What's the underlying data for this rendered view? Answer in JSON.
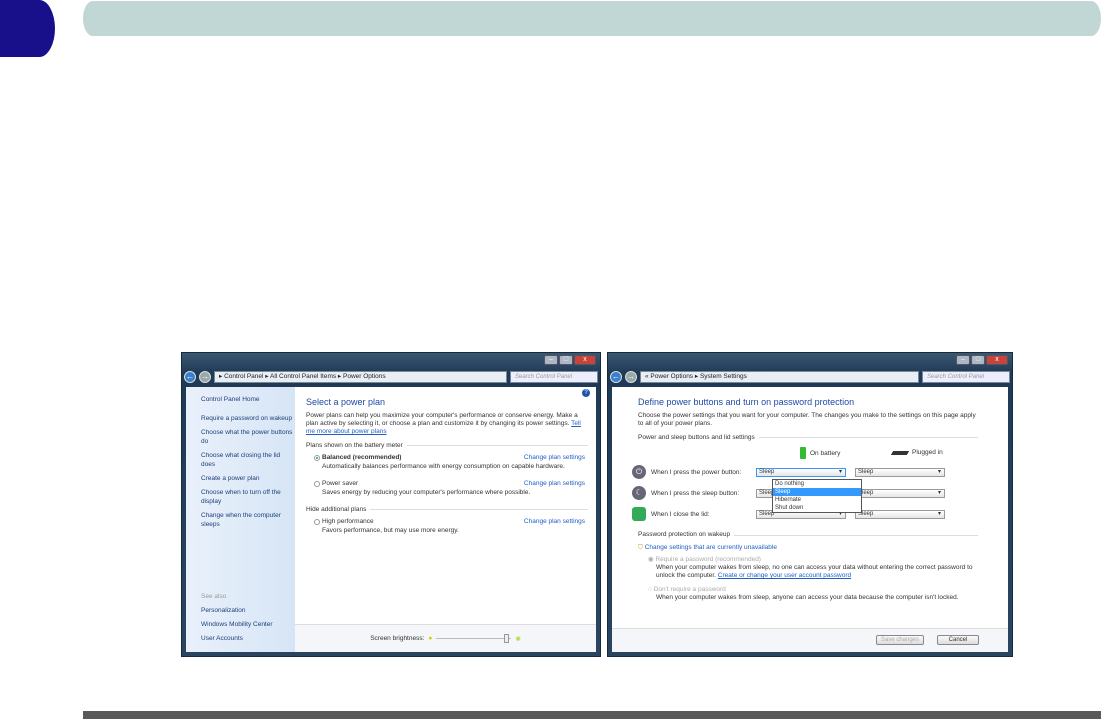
{
  "left_window": {
    "path": [
      "Control Panel",
      "All Control Panel Items",
      "Power Options"
    ],
    "search_placeholder": "Search Control Panel",
    "sidebar": {
      "home": "Control Panel Home",
      "items": [
        "Require a password on wakeup",
        "Choose what the power buttons do",
        "Choose what closing the lid does",
        "Create a power plan",
        "Choose when to turn off the display",
        "Change when the computer sleeps"
      ],
      "see_also": "See also",
      "see_also_items": [
        "Personalization",
        "Windows Mobility Center",
        "User Accounts"
      ]
    },
    "title": "Select a power plan",
    "intro": "Power plans can help you maximize your computer's performance or conserve energy. Make a plan active by selecting it, or choose a plan and customize it by changing its power settings.",
    "intro_link": "Tell me more about power plans",
    "section1": "Plans shown on the battery meter",
    "section2": "Hide additional plans",
    "change_label": "Change plan settings",
    "plans": [
      {
        "name": "Balanced (recommended)",
        "desc": "Automatically balances performance with energy consumption on capable hardware.",
        "selected": true
      },
      {
        "name": "Power saver",
        "desc": "Saves energy by reducing your computer's performance where possible.",
        "selected": false
      },
      {
        "name": "High performance",
        "desc": "Favors performance, but may use more energy.",
        "selected": false
      }
    ],
    "brightness_label": "Screen brightness:",
    "brightness_level": 0.9
  },
  "right_window": {
    "path": [
      "Power Options",
      "System Settings"
    ],
    "search_placeholder": "Search Control Panel",
    "title": "Define power buttons and turn on password protection",
    "intro": "Choose the power settings that you want for your computer. The changes you make to the settings on this page apply to all of your power plans.",
    "section1": "Power and sleep buttons and lid settings",
    "col_battery": "On battery",
    "col_plugged": "Plugged in",
    "rows": [
      {
        "label": "When I press the power button:",
        "battery": "Sleep",
        "plugged": "Sleep"
      },
      {
        "label": "When I press the sleep button:",
        "battery": "Sleep",
        "plugged": "Sleep"
      },
      {
        "label": "When I close the lid:",
        "battery": "Sleep",
        "plugged": "Sleep"
      }
    ],
    "dropdown_options": [
      "Do nothing",
      "Sleep",
      "Hibernate",
      "Shut down"
    ],
    "section2": "Password protection on wakeup",
    "change_unavailable": "Change settings that are currently unavailable",
    "opt1": "Require a password (recommended)",
    "opt1_desc": "When your computer wakes from sleep, no one can access your data without entering the correct password to unlock the computer.",
    "opt1_link": "Create or change your user account password",
    "opt2": "Don't require a password",
    "opt2_desc": "When your computer wakes from sleep, anyone can access your data because the computer isn't locked.",
    "save": "Save changes",
    "cancel": "Cancel"
  }
}
